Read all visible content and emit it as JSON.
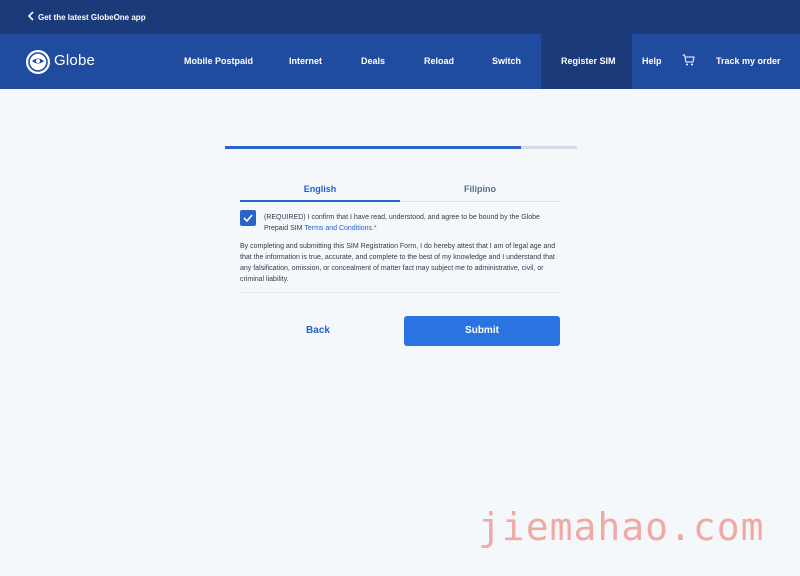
{
  "topbar": {
    "app_link_label": "Get the latest GlobeOne app"
  },
  "header": {
    "brand": "Globe",
    "nav": [
      {
        "label": "Mobile Postpaid"
      },
      {
        "label": "Internet"
      },
      {
        "label": "Deals"
      },
      {
        "label": "Reload"
      },
      {
        "label": "Switch"
      },
      {
        "label": "Register SIM",
        "active": true
      },
      {
        "label": "Help"
      },
      {
        "label": "Track my order"
      }
    ],
    "icons": [
      "chevron-left-icon",
      "globe-logo-icon",
      "cart-icon"
    ]
  },
  "form": {
    "progress": 0.84,
    "tabs": [
      {
        "label": "English",
        "selected": true
      },
      {
        "label": "Filipino",
        "selected": false
      }
    ],
    "consent": {
      "checked": true,
      "text": "(REQUIRED) I confirm that I have read, understood, and agree to be bound by the Globe Prepaid SIM ",
      "link": "Terms and Conditions",
      "required_mark": ".*"
    },
    "attestation": "By completing and submitting this SIM Registration Form, I do hereby attest that I am of legal age and that the information is true, accurate, and complete to the best of my knowledge and I understand that any falsification, omission, or concealment of matter fact may subject me to administrative, civil, or criminal liability.",
    "back_label": "Back",
    "submit_label": "Submit"
  },
  "watermark": "jiemahao.com",
  "colors": {
    "topbar": "#1a3a7a",
    "nav": "#1f4c9e",
    "accent": "#2a73e0",
    "link": "#1f5fcf"
  }
}
